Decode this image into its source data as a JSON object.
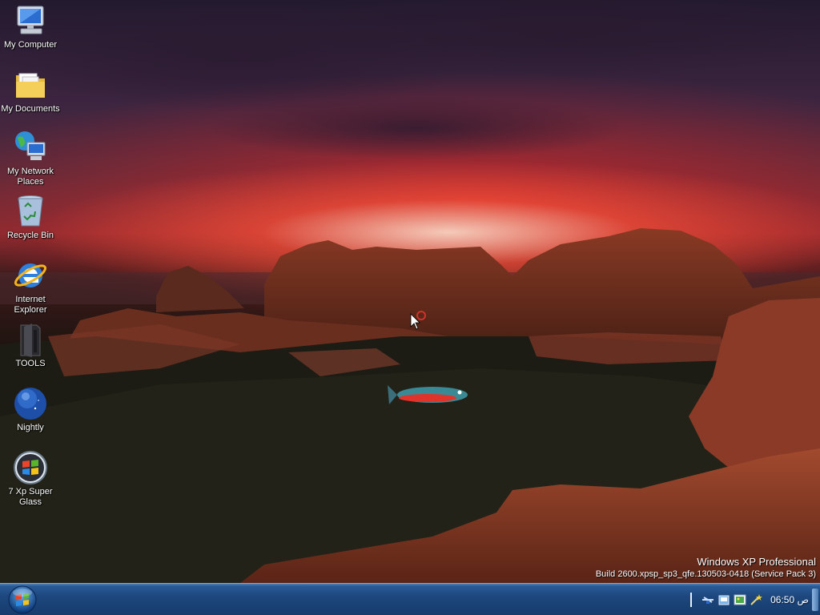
{
  "desktop": {
    "icons": [
      {
        "label": "My Computer",
        "icon": "computer-icon"
      },
      {
        "label": "My Documents",
        "icon": "folder-icon"
      },
      {
        "label": "My Network\nPlaces",
        "icon": "network-icon"
      },
      {
        "label": "Recycle Bin",
        "icon": "recycle-bin-icon"
      },
      {
        "label": "Internet\nExplorer",
        "icon": "internet-explorer-icon"
      },
      {
        "label": "TOOLS",
        "icon": "tools-folder-icon"
      },
      {
        "label": "Nightly",
        "icon": "nightly-globe-icon"
      },
      {
        "label": "7 Xp Super\nGlass",
        "icon": "windows-orb-icon"
      }
    ],
    "watermark": {
      "line1": "Windows XP Professional",
      "line2": "Build 2600.xpsp_sp3_qfe.130503-0418 (Service Pack 3)"
    }
  },
  "taskbar": {
    "start_icon": "windows-start-orb-icon",
    "tray_icons": [
      "network-tray-icon",
      "folder-tray-icon",
      "image-tray-icon",
      "wand-tray-icon"
    ],
    "clock": "ص 06:50"
  },
  "colors": {
    "taskbar": "#1d477e",
    "sky_red": "#b3252a",
    "rock": "#7a3420"
  }
}
